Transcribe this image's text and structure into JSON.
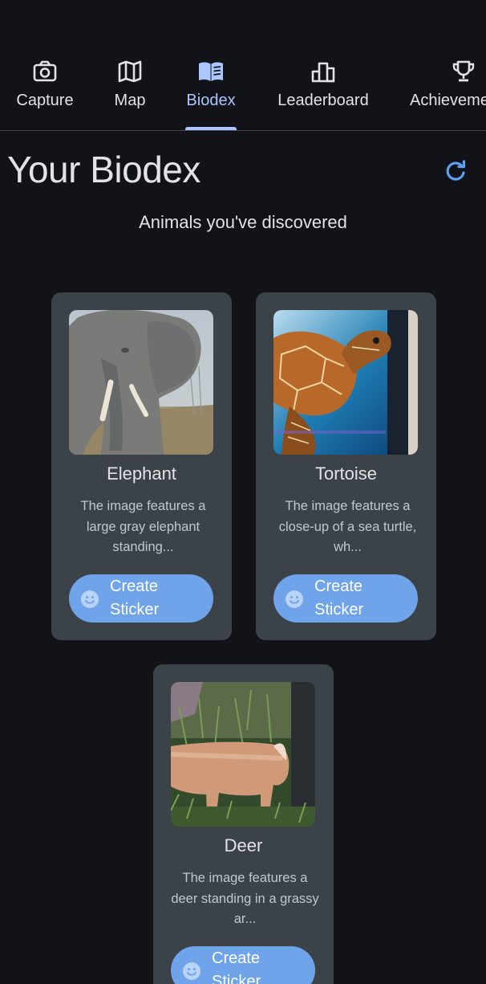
{
  "tabs": [
    {
      "label": "Capture",
      "icon": "camera-icon"
    },
    {
      "label": "Map",
      "icon": "map-icon"
    },
    {
      "label": "Biodex",
      "icon": "book-icon",
      "active": true
    },
    {
      "label": "Leaderboard",
      "icon": "leaderboard-icon"
    },
    {
      "label": "Achievements",
      "icon": "trophy-icon"
    }
  ],
  "tabs_visible_label_achievements": "Achieveme",
  "page": {
    "title": "Your Biodex",
    "subtitle": "Animals you've discovered",
    "refresh_icon": "refresh-icon"
  },
  "animals": [
    {
      "name": "Elephant",
      "description": "The image features a large gray elephant standing...",
      "button_label": "Create Sticker",
      "button_icon": "smiley-icon"
    },
    {
      "name": "Tortoise",
      "description": "The image features a close-up of a sea turtle, wh...",
      "button_label": "Create Sticker",
      "button_icon": "smiley-icon"
    },
    {
      "name": "Deer",
      "description": "The image features a deer standing in a grassy ar...",
      "button_label": "Create Sticker",
      "button_icon": "smiley-icon"
    }
  ],
  "colors": {
    "background": "#111318",
    "card": "#3b4349",
    "accent": "#aac7ff",
    "button": "#6fa3ea"
  }
}
